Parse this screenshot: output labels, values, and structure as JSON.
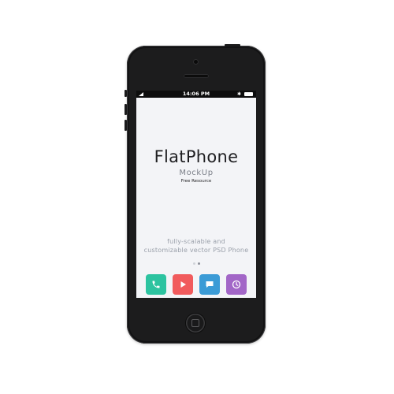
{
  "status_bar": {
    "time": "14:06 PM"
  },
  "splash": {
    "title": "FlatPhone",
    "subtitle": "MockUp",
    "caption": "Free Resource",
    "tagline": [
      "fully-scalable and",
      "customizable vector PSD Phone"
    ]
  },
  "page_dots": {
    "count": 2,
    "active_index": 1
  },
  "dock": {
    "apps": [
      {
        "name": "phone",
        "icon": "phone-icon",
        "color": "#2cc3a0"
      },
      {
        "name": "video",
        "icon": "play-icon",
        "color": "#f15b5d"
      },
      {
        "name": "messages",
        "icon": "chat-bubble-icon",
        "color": "#3b9bd6"
      },
      {
        "name": "clock",
        "icon": "clock-icon",
        "color": "#a266c7"
      }
    ]
  }
}
